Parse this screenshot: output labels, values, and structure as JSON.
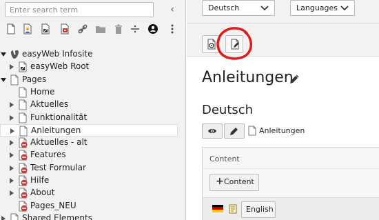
{
  "search": {
    "placeholder": "Enter search term"
  },
  "tree_panel": {
    "collapse_glyph": "‹"
  },
  "tree_toolbar": [
    {
      "name": "new-page-icon"
    },
    {
      "name": "new-page-user-icon"
    },
    {
      "name": "new-page-shortcut-icon"
    },
    {
      "name": "new-page-external-icon"
    },
    {
      "name": "link-icon"
    },
    {
      "name": "folder-icon"
    },
    {
      "name": "trash-icon"
    },
    {
      "name": "divider-icon"
    },
    {
      "name": "backend-layout-icon"
    },
    {
      "name": "more-vertical-icon"
    }
  ],
  "tree": [
    {
      "label": "easyWeb Infosite",
      "icon": "typo3-logo-icon",
      "expander": "open",
      "depth": 0
    },
    {
      "label": "easyWeb Root",
      "icon": "page-shortcut-icon",
      "expander": "closed",
      "depth": 1
    },
    {
      "label": "Pages",
      "icon": "page-icon",
      "expander": "open",
      "depth": 0
    },
    {
      "label": "Home",
      "icon": "page-icon",
      "expander": "none",
      "depth": 1
    },
    {
      "label": "Aktuelles",
      "icon": "page-icon",
      "expander": "closed",
      "depth": 1
    },
    {
      "label": "Funktionalität",
      "icon": "page-icon",
      "expander": "closed",
      "depth": 1
    },
    {
      "label": "Anleitungen",
      "icon": "page-icon",
      "expander": "closed",
      "depth": 1,
      "selected": true
    },
    {
      "label": "Aktuelles - alt",
      "icon": "page-hidden-icon",
      "expander": "closed",
      "depth": 1
    },
    {
      "label": "Features",
      "icon": "page-hidden-icon",
      "expander": "closed",
      "depth": 1
    },
    {
      "label": "Test Formular",
      "icon": "page-hidden-icon",
      "expander": "closed",
      "depth": 1
    },
    {
      "label": "Hilfe",
      "icon": "page-hidden-icon",
      "expander": "closed",
      "depth": 1
    },
    {
      "label": "About",
      "icon": "page-hidden-icon",
      "expander": "closed",
      "depth": 1
    },
    {
      "label": "Pages_NEU",
      "icon": "page-hidden-icon",
      "expander": "none",
      "depth": 1
    },
    {
      "label": "Shared Elements",
      "icon": "page-icon",
      "expander": "closed",
      "depth": 0
    }
  ],
  "header": {
    "language_select": "Deutsch",
    "languages_select": "Languages"
  },
  "actions": [
    {
      "name": "view-page-icon"
    },
    {
      "name": "edit-page-properties-icon",
      "highlighted": true
    }
  ],
  "highlight_color": "#e01b1b",
  "main": {
    "page_title": "Anleitungen",
    "language_heading": "Deutsch",
    "page_reference_label": "Anleitungen",
    "content_header": "Content",
    "add_content_label": "Content",
    "language_button": "English"
  },
  "colors": {
    "hidden_page_red": "#c83c3c",
    "panel_gray": "#f2f2f2"
  }
}
